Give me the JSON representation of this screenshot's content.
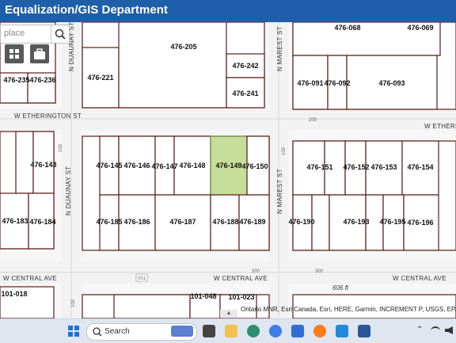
{
  "header": {
    "title": "Equalization/GIS Department"
  },
  "search": {
    "placeholder": "place"
  },
  "toolbar": {
    "grid_button": "grid-icon",
    "basemap_button": "briefcase-icon"
  },
  "parcels": [
    {
      "id": "p205",
      "label": "476-205"
    },
    {
      "id": "p242",
      "label": "476-242"
    },
    {
      "id": "p241",
      "label": "476-241"
    },
    {
      "id": "p221",
      "label": "476-221"
    },
    {
      "id": "p235",
      "label": "476-235"
    },
    {
      "id": "p236",
      "label": "476-236"
    },
    {
      "id": "p068",
      "label": "476-068"
    },
    {
      "id": "p069",
      "label": "476-069"
    },
    {
      "id": "p091",
      "label": "476-091"
    },
    {
      "id": "p092",
      "label": "476-092"
    },
    {
      "id": "p093",
      "label": "476-093"
    },
    {
      "id": "p143",
      "label": "476-143"
    },
    {
      "id": "p145",
      "label": "476-145"
    },
    {
      "id": "p146",
      "label": "476-146"
    },
    {
      "id": "p147",
      "label": "476-147"
    },
    {
      "id": "p148",
      "label": "476-148"
    },
    {
      "id": "p149",
      "label": "476-149"
    },
    {
      "id": "p150",
      "label": "476-150"
    },
    {
      "id": "p151",
      "label": "476-151"
    },
    {
      "id": "p152",
      "label": "476-152"
    },
    {
      "id": "p153",
      "label": "476-153"
    },
    {
      "id": "p154",
      "label": "476-154"
    },
    {
      "id": "p183",
      "label": "476-183"
    },
    {
      "id": "p184",
      "label": "476-184"
    },
    {
      "id": "p185",
      "label": "476-185"
    },
    {
      "id": "p186",
      "label": "476-186"
    },
    {
      "id": "p187",
      "label": "476-187"
    },
    {
      "id": "p188",
      "label": "476-188"
    },
    {
      "id": "p189",
      "label": "476-189"
    },
    {
      "id": "p190",
      "label": "476-190"
    },
    {
      "id": "p193",
      "label": "476-193"
    },
    {
      "id": "p195",
      "label": "476-195"
    },
    {
      "id": "p196",
      "label": "476-196"
    },
    {
      "id": "p048",
      "label": "101-048"
    },
    {
      "id": "p023",
      "label": "101-023"
    },
    {
      "id": "p018",
      "label": "101-018"
    }
  ],
  "selected_parcel": "476-149",
  "streets": {
    "etherington_w": "W ETHERINGTON ST",
    "etherington_e": "W ETHERIN",
    "central_w": "W CENTRAL AVE",
    "central_m": "W CENTRAL AVE",
    "central_e": "W CENTRAL AVE",
    "duaunay_top": "N DUAUNAY ST",
    "duaunay_mid": "N DUAUNAY ST",
    "marest_top": "N MAREST ST",
    "marest_mid": "N MAREST ST"
  },
  "address_numbers": {
    "a1": "200",
    "a2": "100",
    "a3": "100",
    "a4": "300",
    "a5": "001",
    "a6": "100",
    "a7": "300"
  },
  "scale_label": "606 ft",
  "attribution": "Ontario MNR, Esri Canada, Esri, HERE, Garmin, INCREMENT P, USGS, EPA",
  "taskbar": {
    "search_label": "Search"
  },
  "colors": {
    "header": "#1f5ea8",
    "parcel_line": "#5a1a1a",
    "selected_fill": "#c7dd9a"
  }
}
